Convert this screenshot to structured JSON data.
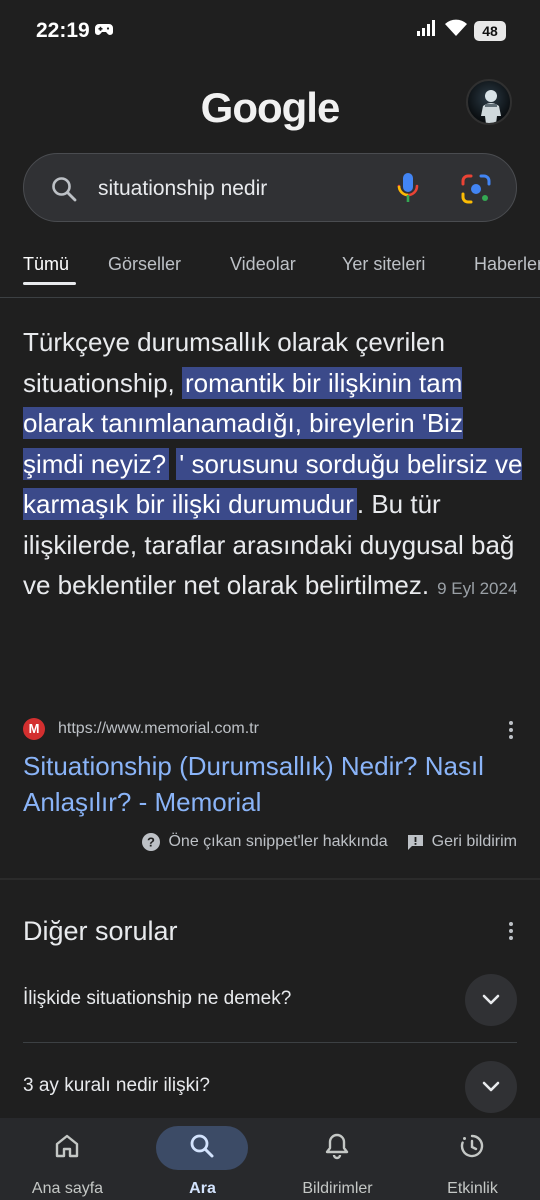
{
  "status_bar": {
    "time": "22:19",
    "battery": "48"
  },
  "header": {
    "logo_text": "Google"
  },
  "search": {
    "query": "situationship nedir"
  },
  "tabs": [
    {
      "label": "Tümü",
      "active": true
    },
    {
      "label": "Görseller"
    },
    {
      "label": "Videolar"
    },
    {
      "label": "Yer siteleri"
    },
    {
      "label": "Haberler"
    }
  ],
  "snippet": {
    "text_before": "Türkçeye durumsallık olarak çevrilen situationship, ",
    "highlight_1": "romantik bir ilişkinin tam olarak tanımlanamadığı, bireylerin 'Biz şimdi neyiz?",
    "highlight_2": "' sorusunu sorduğu belirsiz ve karmaşık bir ilişki durumudur",
    "text_after": ". Bu tür ilişkilerde, taraflar arasındaki duygusal bağ ve beklentiler net olarak belirtilmez.",
    "date": "9 Eyl 2024"
  },
  "source": {
    "favicon_letter": "M",
    "url": "https://www.memorial.com.tr",
    "title": "Situationship (Durumsallık) Nedir? Nasıl Anlaşılır? - Memorial"
  },
  "feedback": {
    "about_label": "Öne çıkan snippet'ler hakkında",
    "feedback_label": "Geri bildirim"
  },
  "people_also_ask": {
    "title": "Diğer sorular",
    "questions": [
      "İlişkide situationship ne demek?",
      "3 ay kuralı nedir ilişki?"
    ]
  },
  "bottom_nav": [
    {
      "label": "Ana sayfa",
      "icon": "home-icon"
    },
    {
      "label": "Ara",
      "icon": "search-icon",
      "active": true
    },
    {
      "label": "Bildirimler",
      "icon": "bell-icon"
    },
    {
      "label": "Etkinlik",
      "icon": "activity-icon"
    }
  ],
  "colors": {
    "background": "#1f1f1f",
    "link": "#8ab4f8",
    "highlight": "#3b4a8a",
    "search_box": "#303134",
    "nav_active_pill": "#3c4b66"
  }
}
